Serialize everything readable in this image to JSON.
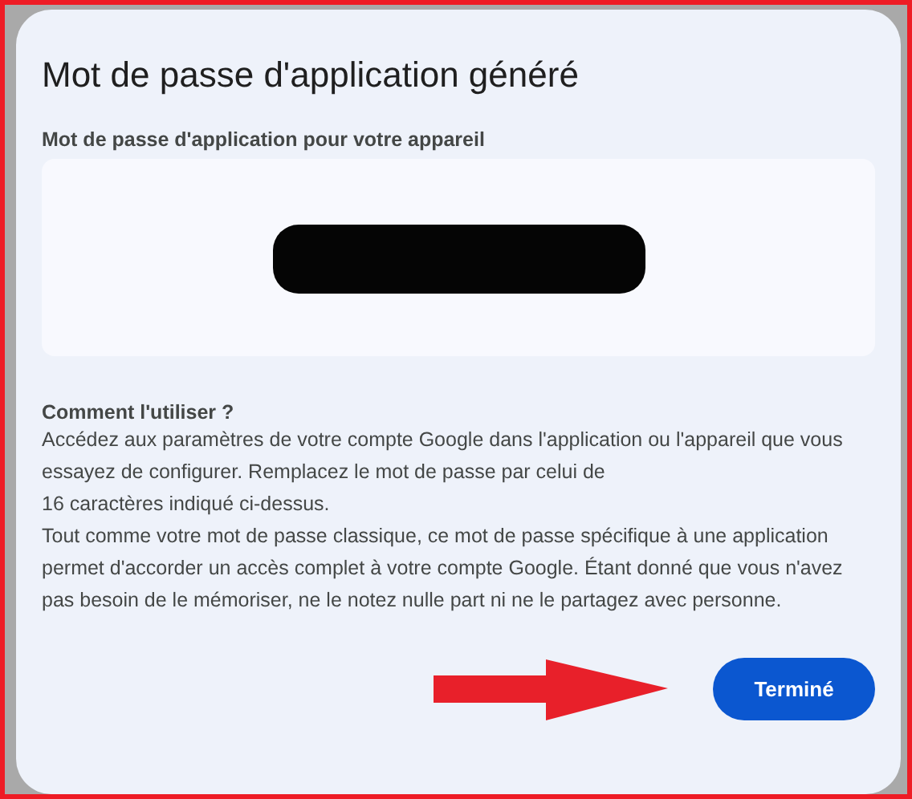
{
  "dialog": {
    "title": "Mot de passe d'application généré",
    "password_label": "Mot de passe d'application pour votre appareil",
    "password_redacted": true,
    "help_heading": "Comment l'utiliser ?",
    "help_paragraphs": [
      "Accédez aux paramètres de votre compte Google dans l'application ou l'appareil que vous essayez de configurer. Remplacez le mot de passe par celui de\n16 caractères indiqué ci-dessus.",
      "Tout comme votre mot de passe classique, ce mot de passe spécifique à une application permet d'accorder un accès complet à votre compte Google. Étant donné que vous n'avez pas besoin de le mémoriser, ne le notez nulle part ni ne le partagez avec personne."
    ],
    "button": "Terminé"
  },
  "annotation_arrow": true
}
